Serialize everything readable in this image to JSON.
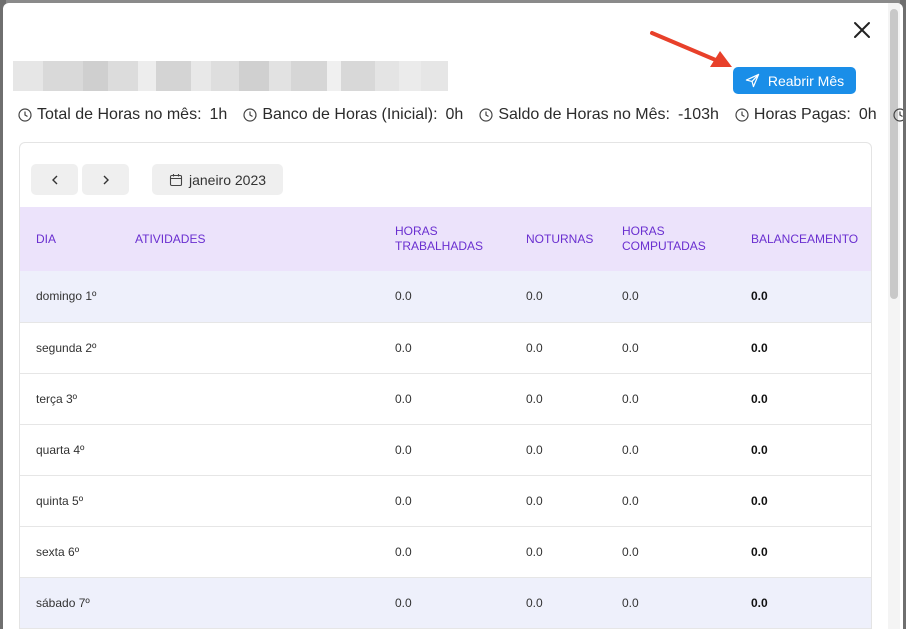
{
  "header": {
    "reopen_label": "Reabrir Mês"
  },
  "stats": [
    {
      "label": "Total de Horas no mês:",
      "value": "1h"
    },
    {
      "label": "Banco de Horas (Inicial):",
      "value": "0h"
    },
    {
      "label": "Saldo de Horas no Mês:",
      "value": "-103h"
    },
    {
      "label": "Horas Pagas:",
      "value": "0h"
    }
  ],
  "calendar": {
    "month_label": "janeiro 2023"
  },
  "table": {
    "headers": {
      "dia": "DIA",
      "atividades": "ATIVIDADES",
      "horas_trabalhadas_1": "HORAS",
      "horas_trabalhadas_2": "TRABALHADAS",
      "noturnas": "NOTURNAS",
      "horas_computadas_1": "HORAS",
      "horas_computadas_2": "COMPUTADAS",
      "balanceamento": "BALANCEAMENTO"
    },
    "rows": [
      {
        "dia": "domingo 1º",
        "atividades": "",
        "trabalhadas": "0.0",
        "noturnas": "0.0",
        "computadas": "0.0",
        "balanceamento": "0.0"
      },
      {
        "dia": "segunda 2º",
        "atividades": "",
        "trabalhadas": "0.0",
        "noturnas": "0.0",
        "computadas": "0.0",
        "balanceamento": "0.0"
      },
      {
        "dia": "terça 3º",
        "atividades": "",
        "trabalhadas": "0.0",
        "noturnas": "0.0",
        "computadas": "0.0",
        "balanceamento": "0.0"
      },
      {
        "dia": "quarta 4º",
        "atividades": "",
        "trabalhadas": "0.0",
        "noturnas": "0.0",
        "computadas": "0.0",
        "balanceamento": "0.0"
      },
      {
        "dia": "quinta 5º",
        "atividades": "",
        "trabalhadas": "0.0",
        "noturnas": "0.0",
        "computadas": "0.0",
        "balanceamento": "0.0"
      },
      {
        "dia": "sexta 6º",
        "atividades": "",
        "trabalhadas": "0.0",
        "noturnas": "0.0",
        "computadas": "0.0",
        "balanceamento": "0.0"
      },
      {
        "dia": "sábado 7º",
        "atividades": "",
        "trabalhadas": "0.0",
        "noturnas": "0.0",
        "computadas": "0.0",
        "balanceamento": "0.0"
      }
    ]
  },
  "icons": {
    "close": "close-icon",
    "send": "send-icon",
    "clock": "clock-icon",
    "prev": "chevron-left-icon",
    "next": "chevron-right-icon",
    "calendar": "calendar-icon"
  },
  "colors": {
    "primary_button": "#1a8ee8",
    "table_header_bg": "#ece3fb",
    "table_header_text": "#6a2fd0",
    "weekend_row_bg": "#eef0fb",
    "annotation_arrow": "#e8402a"
  }
}
